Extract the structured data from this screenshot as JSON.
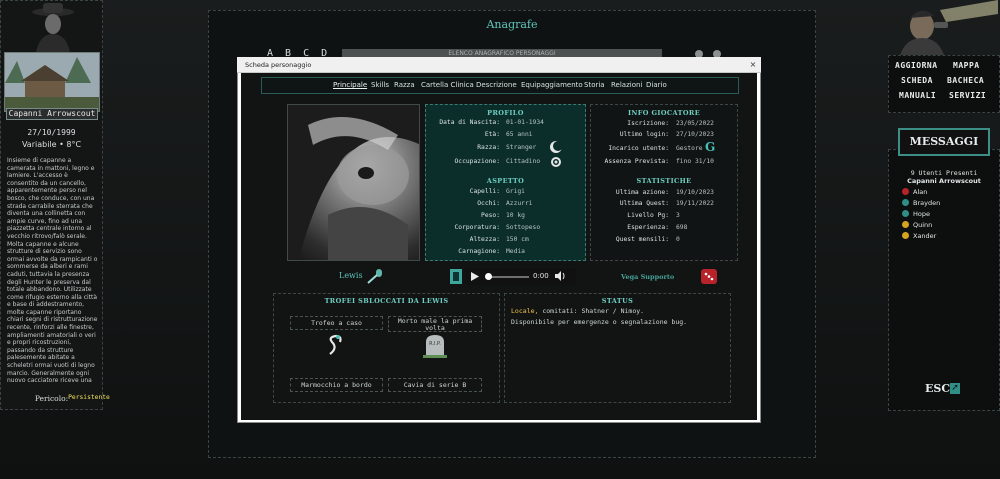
{
  "left": {
    "location_name": "Capanni Arrowscout",
    "date": "27/10/1999",
    "weather": "Variabile • 8°C",
    "description": "Insieme di capanne a camerata in mattoni, legno e lamiere. L'accesso è consentito da un cancello, apparentemente perso nel bosco, che conduce, con una strada carrabile sterrata che diventa una collinetta con ampie curve, fino ad una piazzetta centrale intorno al vecchio ritrovo/falò serale. Molta capanne e alcune strutture di servizio sono ormai avvolte da rampicanti o sommerse da alberi e rami caduti, tuttavia la presenza degli Hunter le preserva dal totale abbandono. Utilizzate come rifugio esterno alla città e base di addestramento, molte capanne riportano chiari segni di ristrutturazione recente, rinforzi alle finestre, ampliamenti amatoriali o veri e propri ricostruzioni, passando da strutture palesemente abitate a scheletri ormai vuoti di legno marcio. Generalmente ogni nuovo cacciatore riceve una",
    "danger_label": "Pericolo:",
    "danger_value": "Persistente"
  },
  "right": {
    "menu": [
      "AGGIORNA",
      "MAPPA",
      "SCHEDA",
      "BACHECA",
      "MANUALI",
      "SERVIZI"
    ],
    "messages_title": "MESSAGGI",
    "online_count": "9 Utenti Presenti",
    "online_place": "Capanni Arrowscout",
    "users": [
      {
        "name": "Alan",
        "color": "#b8232a"
      },
      {
        "name": "Brayden",
        "color": "#2f8f87"
      },
      {
        "name": "Hope",
        "color": "#2f8f87"
      },
      {
        "name": "Quinn",
        "color": "#d6a320"
      },
      {
        "name": "Xander",
        "color": "#d6a320"
      }
    ],
    "exit_label": "ESCI"
  },
  "center": {
    "title": "Anagrafe",
    "alphabet": "A B C D",
    "list_header": "ELENCO ANAGRAFICO PERSONAGGI"
  },
  "modal": {
    "title": "Scheda personaggio",
    "close_glyph": "×",
    "tabs": [
      "Principale",
      "Skills",
      "Razza",
      "Cartella Clinica",
      "Descrizione",
      "Equipaggiamento",
      "Storia",
      "Relazioni",
      "Diario"
    ],
    "profilo": {
      "title": "PROFILO",
      "rows": [
        {
          "label": "Data di Nascita:",
          "value": "01-01-1934"
        },
        {
          "label": "Età:",
          "value": "65 anni"
        },
        {
          "label": "Razza:",
          "value": "Stranger"
        },
        {
          "label": "Occupazione:",
          "value": "Cittadino"
        }
      ]
    },
    "aspetto": {
      "title": "ASPETTO",
      "rows": [
        {
          "label": "Capelli:",
          "value": "Grigi"
        },
        {
          "label": "Occhi:",
          "value": "Azzurri"
        },
        {
          "label": "Peso:",
          "value": "10 kg"
        },
        {
          "label": "Corporatura:",
          "value": "Sottopeso"
        },
        {
          "label": "Altezza:",
          "value": "150 cm"
        },
        {
          "label": "Carnagione:",
          "value": "Media"
        }
      ]
    },
    "info": {
      "title": "INFO GIOCATORE",
      "rows": [
        {
          "label": "Iscrizione:",
          "value": "23/05/2022"
        },
        {
          "label": "Ultimo login:",
          "value": "27/10/2023"
        },
        {
          "label": "Incarico utente:",
          "value": "Gestore"
        },
        {
          "label": "Assenza Prevista:",
          "value": "fino 31/10"
        }
      ]
    },
    "stats": {
      "title": "STATISTICHE",
      "rows": [
        {
          "label": "Ultima azione:",
          "value": "19/10/2023"
        },
        {
          "label": "Ultima Quest:",
          "value": "19/11/2022"
        },
        {
          "label": "Livello Pg:",
          "value": "3"
        },
        {
          "label": "Esperienza:",
          "value": "698"
        },
        {
          "label": "Quest mensili:",
          "value": "0"
        }
      ]
    },
    "character_name": "Lewis",
    "player": {
      "time": "0:00"
    },
    "support_label": "Vega Supporto",
    "trofei": {
      "title": "TROFEI SBLOCCATI DA LEWIS",
      "items": [
        "Trofeo a caso",
        "Morto male la prima volta",
        "Marmocchio a bordo",
        "Cavia di serie B"
      ]
    },
    "status": {
      "title": "STATUS",
      "line1_label": "Locale,",
      "line1_value": "comitati: Shatner / Nimoy.",
      "line2": "Disponibile per emergenze o segnalazione bug."
    }
  }
}
